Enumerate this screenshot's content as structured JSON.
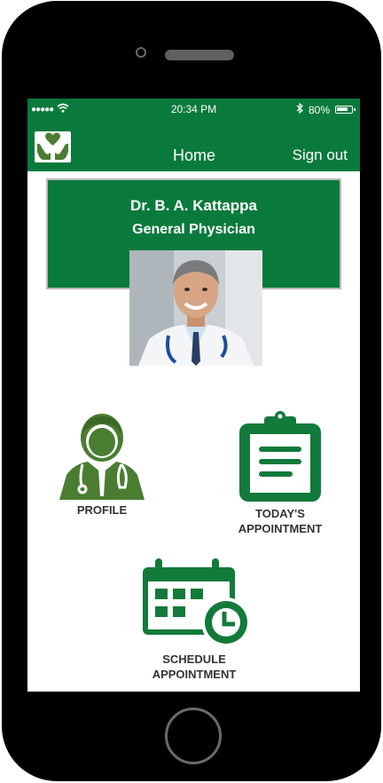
{
  "status_bar": {
    "signal": "●●●●●",
    "time": "20:34 PM",
    "battery": "80%",
    "battery_level": 0.8
  },
  "nav": {
    "title": "Home",
    "signout": "Sign out"
  },
  "doctor": {
    "name": "Dr. B. A. Kattappa",
    "specialty": "General Physician"
  },
  "menu": {
    "profile": "PROFILE",
    "todays_line1": "TODAY'S",
    "todays_line2": "APPOINTMENT",
    "schedule_line1": "SCHEDULE",
    "schedule_line2": "APPOINTMENT"
  },
  "colors": {
    "brand_green": "#0a7a3c",
    "icon_green": "#4a7d32",
    "dark_green": "#127a3a"
  }
}
